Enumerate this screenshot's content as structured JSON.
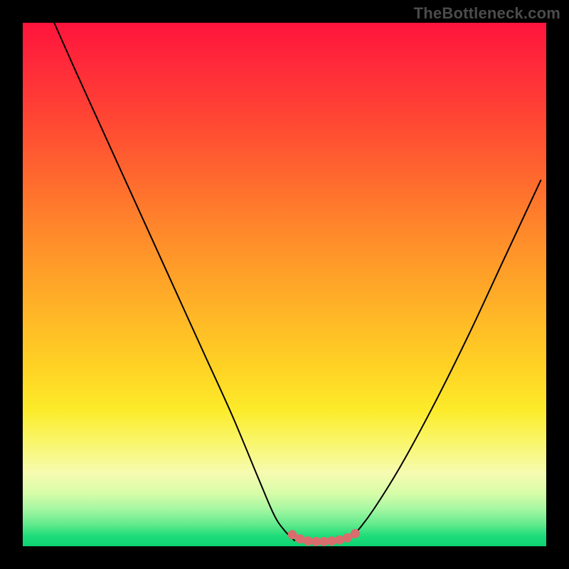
{
  "watermark": {
    "text": "TheBottleneck.com"
  },
  "chart_data": {
    "type": "line",
    "title": "",
    "xlabel": "",
    "ylabel": "",
    "xlim": [
      0,
      100
    ],
    "ylim": [
      0,
      100
    ],
    "gradient_stops": [
      {
        "pct": 0,
        "color": "#ff143c"
      },
      {
        "pct": 8,
        "color": "#ff2a3a"
      },
      {
        "pct": 18,
        "color": "#ff4534"
      },
      {
        "pct": 30,
        "color": "#ff6a2e"
      },
      {
        "pct": 42,
        "color": "#ff8f2a"
      },
      {
        "pct": 55,
        "color": "#ffb427"
      },
      {
        "pct": 66,
        "color": "#ffd324"
      },
      {
        "pct": 74,
        "color": "#fceb2a"
      },
      {
        "pct": 80,
        "color": "#f9f66a"
      },
      {
        "pct": 86,
        "color": "#f6fbb0"
      },
      {
        "pct": 90,
        "color": "#d6fca8"
      },
      {
        "pct": 93,
        "color": "#a3f7a1"
      },
      {
        "pct": 96,
        "color": "#5de98b"
      },
      {
        "pct": 98,
        "color": "#1fdc7a"
      },
      {
        "pct": 100,
        "color": "#0cd272"
      }
    ],
    "series": [
      {
        "name": "left-curve",
        "x": [
          6,
          10,
          15,
          20,
          25,
          30,
          35,
          40,
          45,
          48,
          50,
          52
        ],
        "y": [
          100,
          91,
          80,
          69,
          58,
          47,
          36,
          25,
          13,
          6,
          3,
          1
        ]
      },
      {
        "name": "right-curve",
        "x": [
          62,
          64,
          67,
          72,
          78,
          85,
          92,
          99
        ],
        "y": [
          1,
          3,
          7,
          15,
          26,
          40,
          55,
          70
        ]
      },
      {
        "name": "valley-dots",
        "x": [
          51.5,
          53,
          54.5,
          56,
          57.5,
          59,
          60.5,
          62,
          63.5
        ],
        "y": [
          2.2,
          1.4,
          1.0,
          0.9,
          0.9,
          1.0,
          1.2,
          1.6,
          2.4
        ]
      }
    ],
    "colors": {
      "curve": "#000000",
      "dots": "#d96c6c"
    }
  }
}
